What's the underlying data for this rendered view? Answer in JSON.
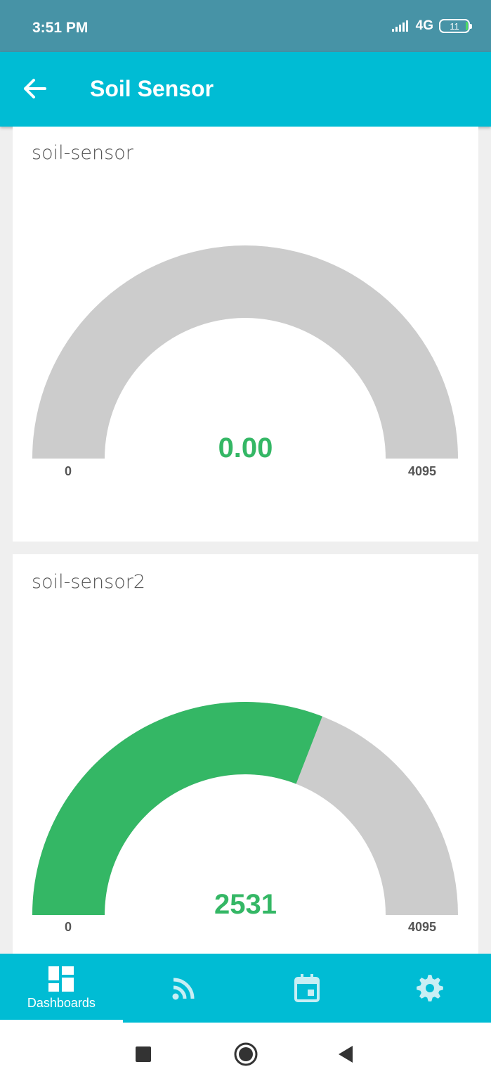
{
  "status_bar": {
    "time": "3:51 PM",
    "network": "4G",
    "battery": "11"
  },
  "app_bar": {
    "back_icon": "arrow-left-icon",
    "title": "Soil Sensor"
  },
  "gauges": [
    {
      "title": "soil-sensor",
      "value": 0,
      "value_text": "0.00",
      "min": "0",
      "max": "4095",
      "fill_color": "#34b765",
      "track_color": "#cccccc"
    },
    {
      "title": "soil-sensor2",
      "value": 2531,
      "value_text": "2531",
      "min": "0",
      "max": "4095",
      "fill_color": "#34b765",
      "track_color": "#cccccc"
    }
  ],
  "bottom_nav": {
    "items": [
      {
        "label": "Dashboards",
        "icon": "dashboard-icon",
        "active": true
      },
      {
        "label": "",
        "icon": "rss-feed-icon",
        "active": false
      },
      {
        "label": "",
        "icon": "calendar-icon",
        "active": false
      },
      {
        "label": "",
        "icon": "gear-icon",
        "active": false
      }
    ]
  },
  "system_nav": {
    "icons": [
      "square-recents-icon",
      "circle-home-icon",
      "triangle-back-icon"
    ]
  },
  "colors": {
    "accent": "#00bcd4",
    "status_bar": "#4793a6",
    "value_green": "#34b765"
  }
}
